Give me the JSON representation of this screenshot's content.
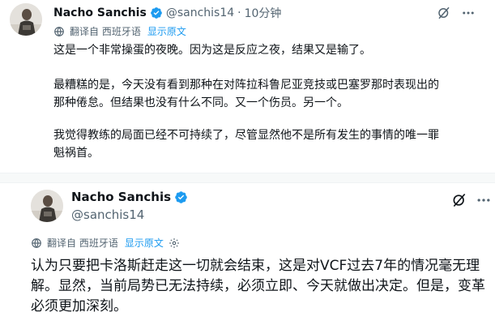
{
  "tweet1": {
    "author_name": "Nacho Sanchis",
    "handle": "@sanchis14",
    "separator": "·",
    "time": "10分钟",
    "translated_from": "翻译自 西班牙语",
    "show_original": "显示原文",
    "paragraphs": [
      "这是一个非常操蛋的夜晚。因为这是反应之夜，结果又是输了。",
      "最糟糕的是，今天没有看到那种在对阵拉科鲁尼亚竞技或巴塞罗那时表现出的",
      "那种倦怠。但结果也没有什么不同。又一个伤员。另一个。",
      "我觉得教练的局面已经不可持续了，尽管显然他不是所有发生的事情的唯一罪",
      "魁祸首。"
    ],
    "icons": [
      "grok-icon",
      "more-icon",
      "translate-icon",
      "verified-badge-icon"
    ]
  },
  "tweet2": {
    "author_name": "Nacho Sanchis",
    "handle": "@sanchis14",
    "translated_from": "翻译自 西班牙语",
    "show_original": "显示原文",
    "paragraphs": [
      "认为只要把卡洛斯赶走这一切就会结束，这是对VCF过去7年的情况毫无理",
      "解。显然，当前局势已无法持续，必须立即、今天就做出决定。但是，变革",
      "必须更加深刻。"
    ],
    "icons": [
      "grok-icon",
      "more-icon",
      "translate-icon",
      "settings-gear-icon",
      "verified-badge-icon"
    ]
  },
  "colors": {
    "text": "#0f1419",
    "secondary": "#536471",
    "link": "#1d9bf0",
    "verified": "#1d9bf0",
    "divider": "#f7f9f9"
  }
}
